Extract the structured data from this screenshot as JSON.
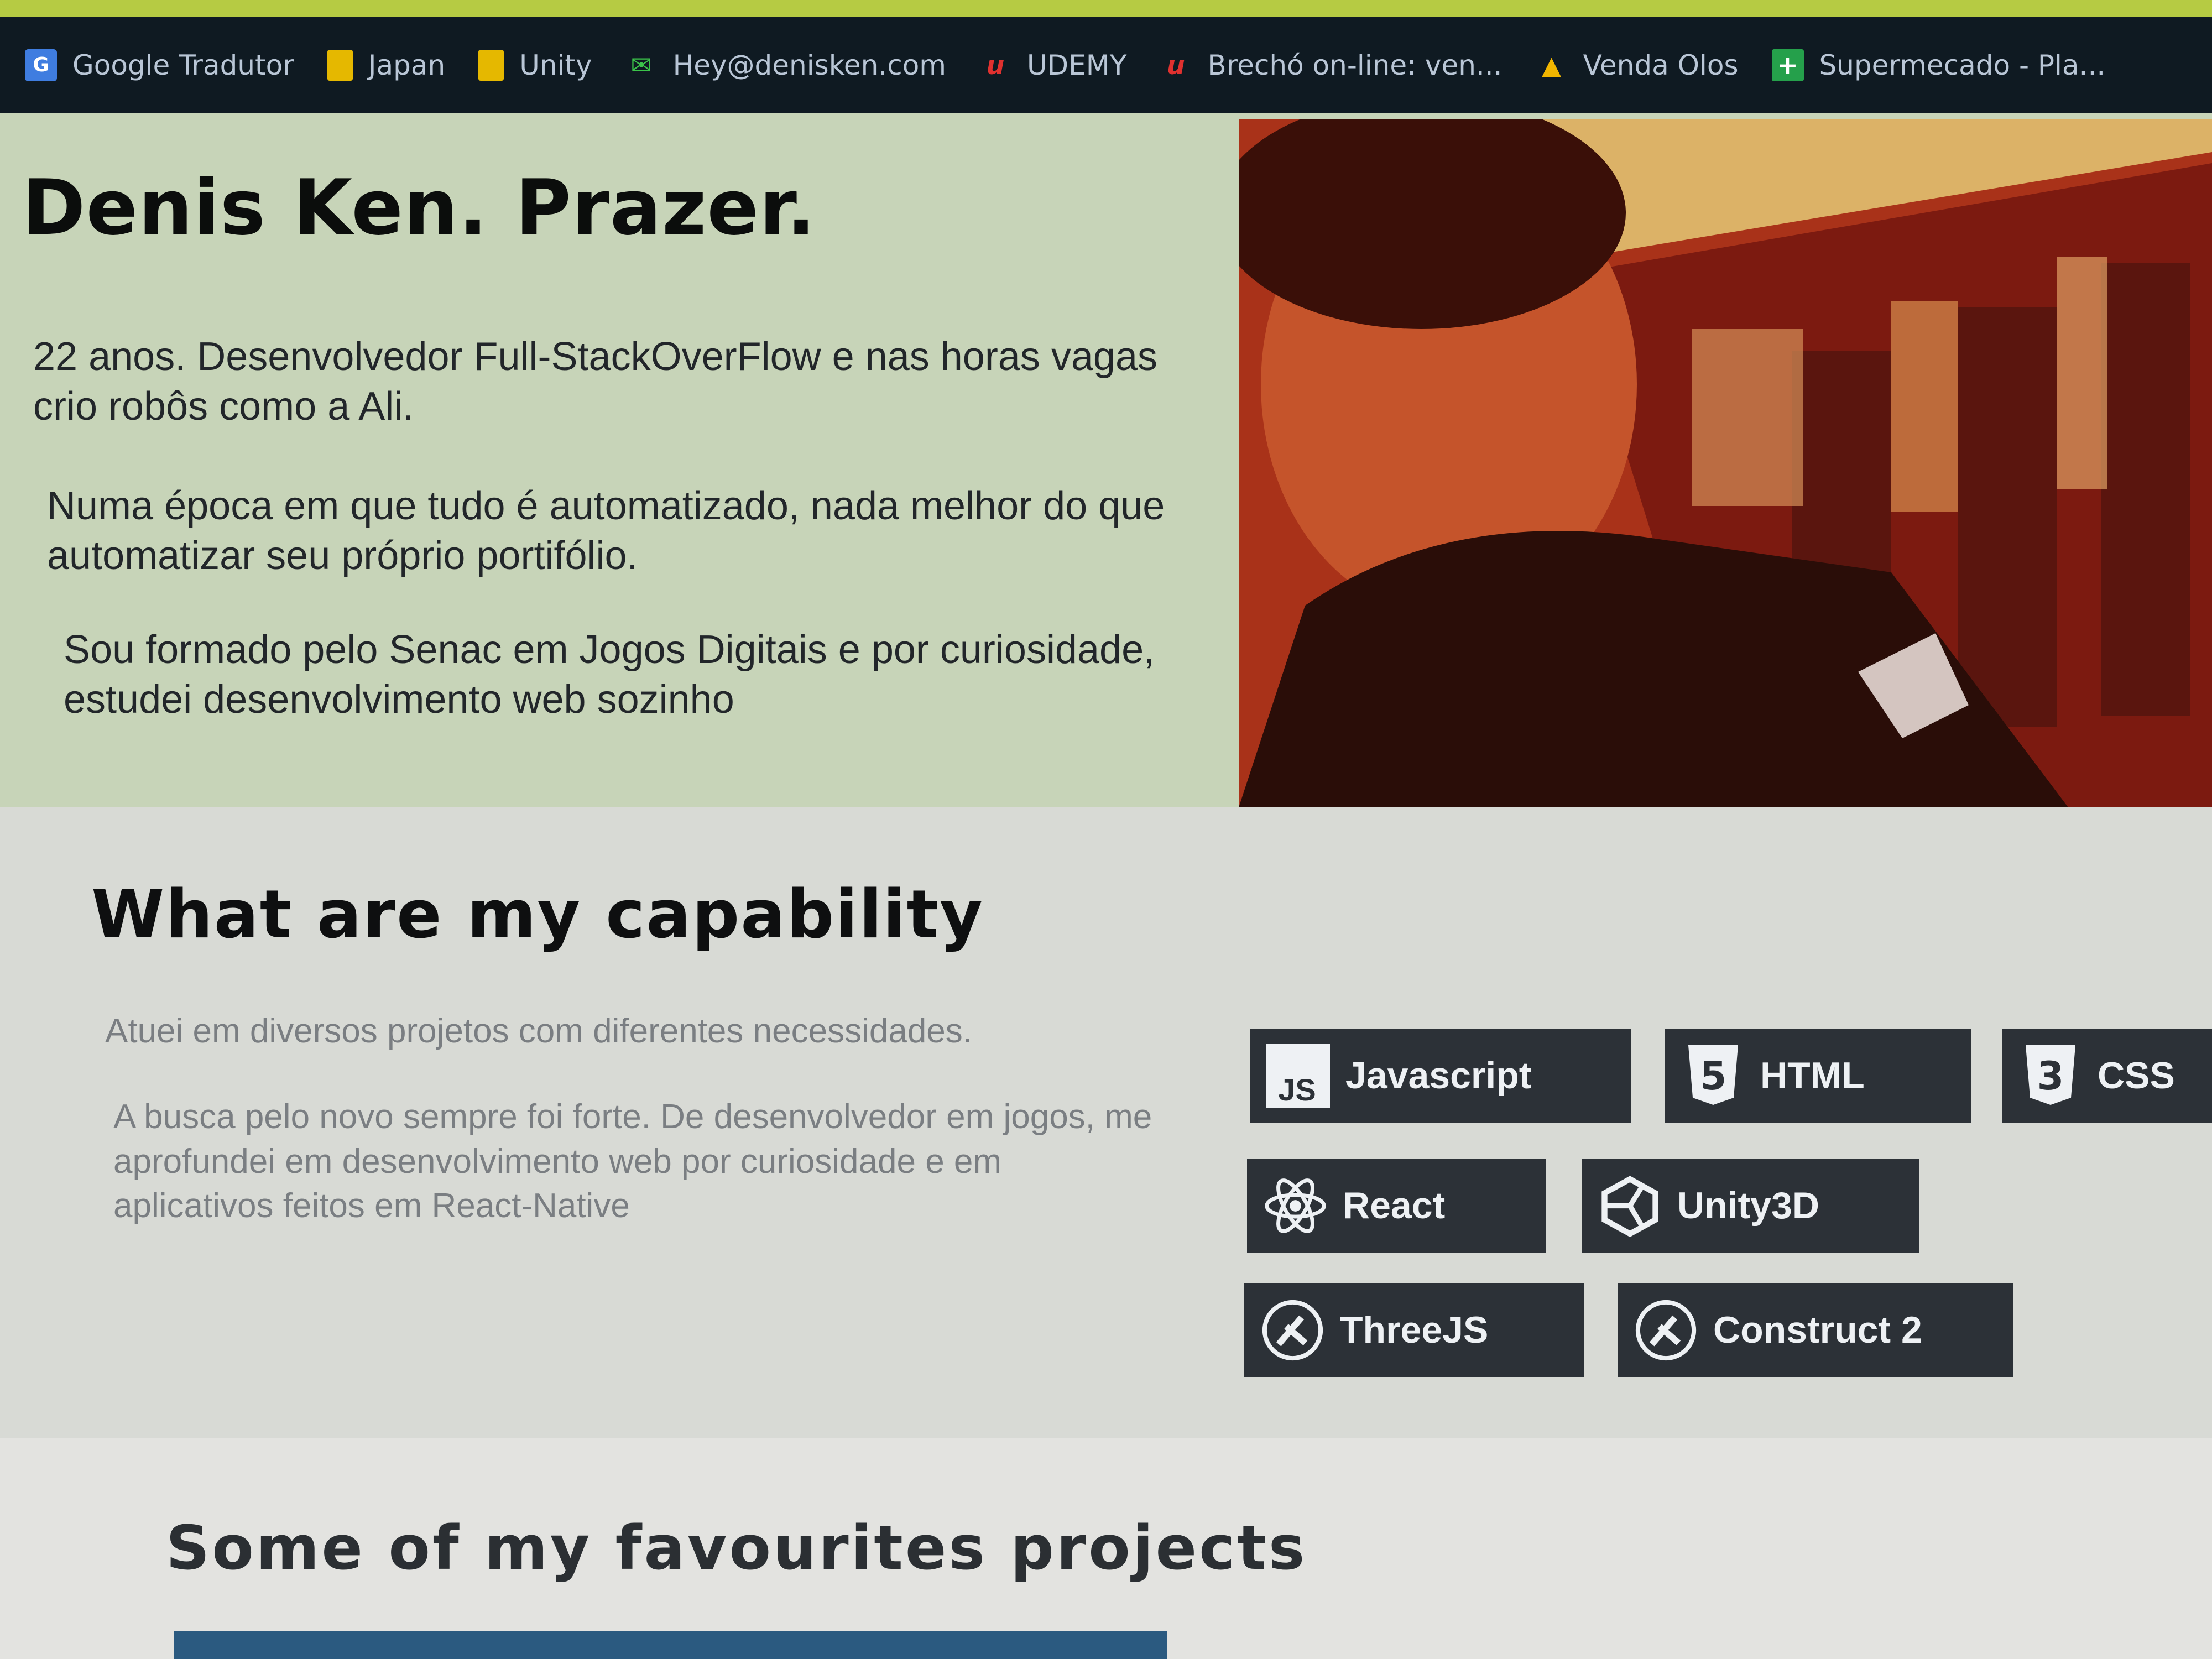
{
  "bookmarks": [
    {
      "label": "Google Tradutor",
      "icon": "google-translate-icon"
    },
    {
      "label": "Japan",
      "icon": "folder-icon"
    },
    {
      "label": "Unity",
      "icon": "folder-icon"
    },
    {
      "label": "Hey@denisken.com",
      "icon": "mail-icon"
    },
    {
      "label": "UDEMY",
      "icon": "udemy-icon"
    },
    {
      "label": "Brechó on-line: ven...",
      "icon": "udemy-icon"
    },
    {
      "label": "Venda Olos",
      "icon": "drive-icon"
    },
    {
      "label": "Supermecado - Pla...",
      "icon": "sheets-icon"
    }
  ],
  "hero": {
    "title": "Denis Ken. Prazer.",
    "p1": "22 anos. Desenvolvedor Full-StackOverFlow e nas horas vagas crio robôs como a Ali.",
    "p2": "Numa época em que tudo é automatizado, nada melhor do que automatizar seu próprio portifólio.",
    "p3": "Sou formado pelo Senac em Jogos Digitais e por curiosidade, estudei desenvolvimento web sozinho"
  },
  "skills": {
    "title": "What are my capability",
    "p1": "Atuei em diversos projetos com diferentes necessidades.",
    "p2": "A busca pelo novo sempre foi forte. De desenvolvedor em jogos, me aprofundei em desenvolvimento web por curiosidade e em aplicativos feitos em React-Native",
    "tags": [
      {
        "label": "Javascript",
        "icon": "js-icon"
      },
      {
        "label": "HTML",
        "icon": "html5-icon"
      },
      {
        "label": "CSS",
        "icon": "css3-icon"
      },
      {
        "label": "React",
        "icon": "react-icon"
      },
      {
        "label": "Unity3D",
        "icon": "unity-icon"
      },
      {
        "label": "ThreeJS",
        "icon": "threejs-icon"
      },
      {
        "label": "Construct 2",
        "icon": "construct-icon"
      }
    ]
  },
  "projects": {
    "title": "Some of my favourites projects"
  },
  "colors": {
    "bookmarks_bg": "#0f1a22",
    "hero_bg": "#c7d4b8",
    "tag_bg": "#2c3137",
    "accent_bar": "#2b5a80"
  }
}
